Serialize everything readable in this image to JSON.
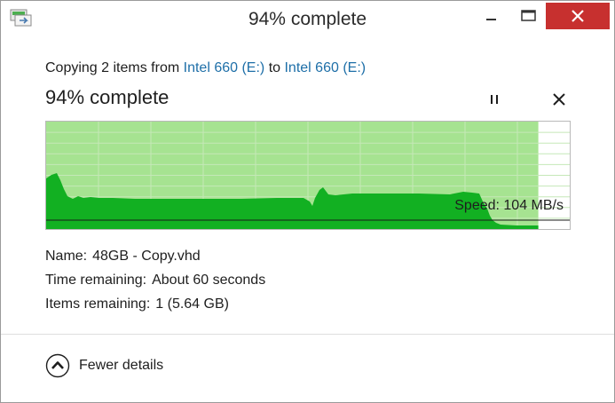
{
  "window": {
    "title": "94% complete"
  },
  "header": {
    "copy_prefix": "Copying 2 items from",
    "source": "Intel 660 (E:)",
    "copy_middle": "to",
    "destination": "Intel 660 (E:)",
    "status": "94% complete",
    "progress_fraction": 0.94
  },
  "graph": {
    "speed_label": "Speed: 104 MB/s",
    "colors": {
      "progress_fill": "#a6e391",
      "speed_fill": "#12b022",
      "grid": "#c5e8b8",
      "line": "#1a1a1a"
    }
  },
  "details": {
    "name_label": "Name:",
    "name_value": "48GB - Copy.vhd",
    "time_label": "Time remaining:",
    "time_value": "About 60 seconds",
    "items_label": "Items remaining:",
    "items_value": "1 (5.64 GB)"
  },
  "footer": {
    "toggle_label": "Fewer details"
  }
}
